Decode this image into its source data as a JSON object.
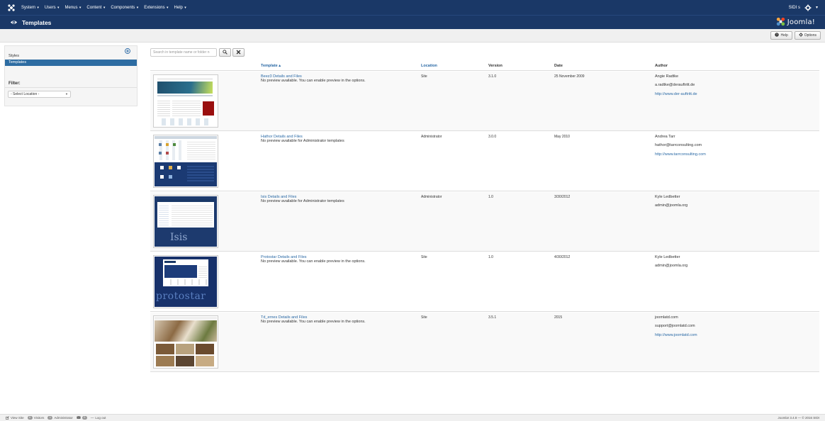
{
  "navbar": {
    "menus": [
      "System",
      "Users",
      "Menus",
      "Content",
      "Components",
      "Extensions",
      "Help"
    ],
    "site_name": "SIDI s",
    "bg_color": "#1a3867"
  },
  "subhead": {
    "title": "Templates",
    "logo_text": "Joomla!"
  },
  "toolbar": {
    "help_label": "Help",
    "options_label": "Options"
  },
  "sidebar": {
    "items": [
      {
        "label": "Styles",
        "active": false
      },
      {
        "label": "Templates",
        "active": true
      }
    ],
    "filter_label": "Filter:",
    "location_select": "- Select Location -"
  },
  "search": {
    "placeholder": "Search in template name or folder n"
  },
  "table": {
    "columns": {
      "template": "Template",
      "location": "Location",
      "version": "Version",
      "date": "Date",
      "author": "Author"
    },
    "rows": [
      {
        "name": "Beez3 Details and Files",
        "description": "No preview available. You can enable preview in the options.",
        "location": "Site",
        "version": "3.1.0",
        "date": "25 November 2009",
        "author": "Angie Radtke",
        "email": "a.radtke@derauftritt.de",
        "url": "http://www.der-auftritt.de"
      },
      {
        "name": "Hathor Details and Files",
        "description": "No preview available for Administrator templates",
        "location": "Administrator",
        "version": "3.0.0",
        "date": "May 2010",
        "author": "Andrea Tarr",
        "email": "hathor@tarrconsulting.com",
        "url": "http://www.tarrconsulting.com"
      },
      {
        "name": "Isis Details and Files",
        "description": "No preview available for Administrator templates",
        "location": "Administrator",
        "version": "1.0",
        "date": "3/30/2012",
        "author": "Kyle Ledbetter",
        "email": "admin@joomla.org",
        "url": ""
      },
      {
        "name": "Protostar Details and Files",
        "description": "No preview available. You can enable preview in the options.",
        "location": "Site",
        "version": "1.0",
        "date": "4/30/2012",
        "author": "Kyle Ledbetter",
        "email": "admin@joomla.org",
        "url": ""
      },
      {
        "name": "Td_ernes Details and Files",
        "description": "No preview available. You can enable preview in the options.",
        "location": "Site",
        "version": "3.5.1",
        "date": "2015",
        "author": "joomlatd.com",
        "email": "support@joomlatd.com",
        "url": "http://www.joomlatd.com"
      }
    ]
  },
  "thumb_labels": {
    "isis": "Isis",
    "protostar": "protostar"
  },
  "footer": {
    "view_site": "View Site",
    "visitors_count": "0",
    "visitors": "Visitors",
    "admin_count": "1",
    "administrator": "Administrator",
    "messages_count": "0",
    "logout": "Log out",
    "copyright": "Joomla! 3.4.8 — © 2016 SIDI"
  },
  "colors": {
    "link": "#2a69a5",
    "active_sidebar": "#2d6ca2"
  }
}
